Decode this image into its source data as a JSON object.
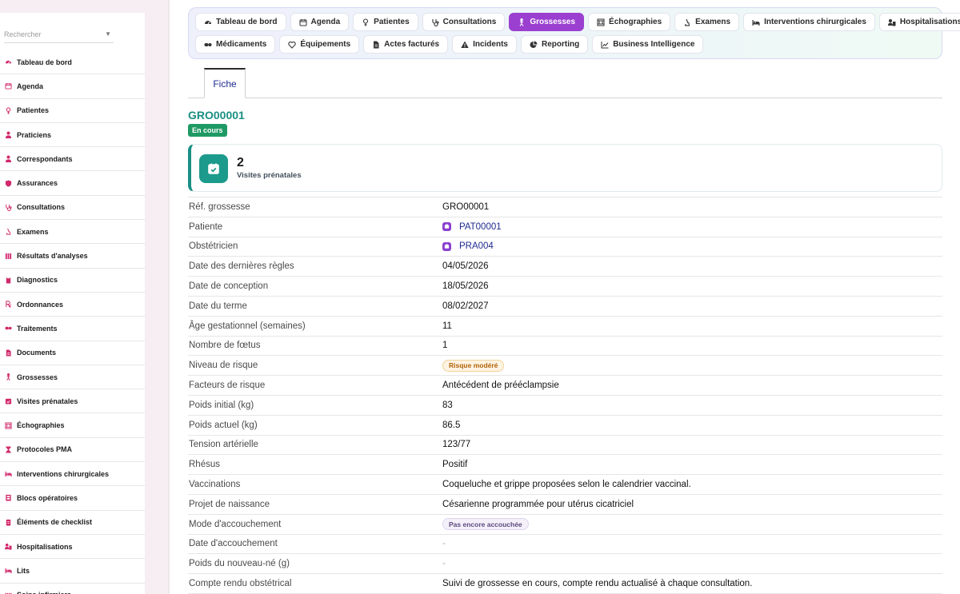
{
  "sidebar": {
    "search_placeholder": "Rechercher",
    "items": [
      {
        "label": "Tableau de bord",
        "icon": "gauge-icon"
      },
      {
        "label": "Agenda",
        "icon": "calendar-icon"
      },
      {
        "label": "Patientes",
        "icon": "female-icon"
      },
      {
        "label": "Praticiens",
        "icon": "doctor-icon"
      },
      {
        "label": "Correspondants",
        "icon": "person-icon"
      },
      {
        "label": "Assurances",
        "icon": "shield-icon"
      },
      {
        "label": "Consultations",
        "icon": "stethoscope-icon"
      },
      {
        "label": "Examens",
        "icon": "microscope-icon"
      },
      {
        "label": "Résultats d'analyses",
        "icon": "lab-icon"
      },
      {
        "label": "Diagnostics",
        "icon": "clipboard-icon"
      },
      {
        "label": "Ordonnances",
        "icon": "prescription-icon"
      },
      {
        "label": "Traitements",
        "icon": "pills-icon"
      },
      {
        "label": "Documents",
        "icon": "document-icon"
      },
      {
        "label": "Grossesses",
        "icon": "pregnancy-icon"
      },
      {
        "label": "Visites prénatales",
        "icon": "calendar-check-icon"
      },
      {
        "label": "Échographies",
        "icon": "ultrasound-icon"
      },
      {
        "label": "Protocoles PMA",
        "icon": "hourglass-icon"
      },
      {
        "label": "Interventions chirurgicales",
        "icon": "bed-icon"
      },
      {
        "label": "Blocs opératoires",
        "icon": "door-icon"
      },
      {
        "label": "Éléments de checklist",
        "icon": "checklist-icon"
      },
      {
        "label": "Hospitalisations",
        "icon": "hospital-icon"
      },
      {
        "label": "Lits",
        "icon": "bed-icon"
      },
      {
        "label": "Soins infirmiers",
        "icon": "nurse-icon"
      }
    ]
  },
  "topnav": {
    "row1": [
      {
        "label": "Tableau de bord",
        "icon": "gauge-icon",
        "active": false
      },
      {
        "label": "Agenda",
        "icon": "calendar-icon",
        "active": false
      },
      {
        "label": "Patientes",
        "icon": "female-icon",
        "active": false
      },
      {
        "label": "Consultations",
        "icon": "stethoscope-icon",
        "active": false
      },
      {
        "label": "Grossesses",
        "icon": "pregnancy-icon",
        "active": true
      },
      {
        "label": "Échographies",
        "icon": "ultrasound-icon",
        "active": false
      },
      {
        "label": "Examens",
        "icon": "microscope-icon",
        "active": false
      },
      {
        "label": "Interventions chirurgicales",
        "icon": "bed-icon",
        "active": false
      },
      {
        "label": "Hospitalisations",
        "icon": "hospital-icon",
        "active": false
      }
    ],
    "row2": [
      {
        "label": "Médicaments",
        "icon": "pills-icon",
        "active": false
      },
      {
        "label": "Équipements",
        "icon": "heart-pulse-icon",
        "active": false
      },
      {
        "label": "Actes facturés",
        "icon": "document-icon",
        "active": false
      },
      {
        "label": "Incidents",
        "icon": "warning-icon",
        "active": false
      },
      {
        "label": "Reporting",
        "icon": "pie-chart-icon",
        "active": false
      },
      {
        "label": "Business Intelligence",
        "icon": "line-chart-icon",
        "active": false
      }
    ]
  },
  "tabs": {
    "fiche": "Fiche"
  },
  "record": {
    "title": "GRO00001",
    "status": "En cours"
  },
  "stat": {
    "value": "2",
    "label": "Visites prénatales",
    "icon": "calendar-check-icon"
  },
  "colors": {
    "accent": "#9b3fd0",
    "teal": "#1a8f83",
    "status_green": "#1f9a64",
    "sidebar_icon": "#d1296b"
  },
  "details": [
    {
      "label": "Réf. grossesse",
      "value": "GRO00001",
      "type": "text"
    },
    {
      "label": "Patiente",
      "value": "PAT00001",
      "type": "link"
    },
    {
      "label": "Obstétricien",
      "value": "PRA004",
      "type": "link"
    },
    {
      "label": "Date des dernières règles",
      "value": "04/05/2026",
      "type": "text"
    },
    {
      "label": "Date de conception",
      "value": "18/05/2026",
      "type": "text"
    },
    {
      "label": "Date du terme",
      "value": "08/02/2027",
      "type": "text"
    },
    {
      "label": "Âge gestationnel (semaines)",
      "value": "11",
      "type": "text"
    },
    {
      "label": "Nombre de fœtus",
      "value": "1",
      "type": "text"
    },
    {
      "label": "Niveau de risque",
      "value": "Risque modéré",
      "type": "pill-warn"
    },
    {
      "label": "Facteurs de risque",
      "value": "Antécédent de prééclampsie",
      "type": "text"
    },
    {
      "label": "Poids initial (kg)",
      "value": "83",
      "type": "text"
    },
    {
      "label": "Poids actuel (kg)",
      "value": "86.5",
      "type": "text"
    },
    {
      "label": "Tension artérielle",
      "value": "123/77",
      "type": "text"
    },
    {
      "label": "Rhésus",
      "value": "Positif",
      "type": "text"
    },
    {
      "label": "Vaccinations",
      "value": "Coqueluche et grippe proposées selon le calendrier vaccinal.",
      "type": "text"
    },
    {
      "label": "Projet de naissance",
      "value": "Césarienne programmée pour utérus cicatriciel",
      "type": "text"
    },
    {
      "label": "Mode d'accouchement",
      "value": "Pas encore accouchée",
      "type": "pill-neutral"
    },
    {
      "label": "Date d'accouchement",
      "value": "-",
      "type": "muted"
    },
    {
      "label": "Poids du nouveau-né (g)",
      "value": "-",
      "type": "muted"
    },
    {
      "label": "Compte rendu obstétrical",
      "value": "Suivi de grossesse en cours, compte rendu actualisé à chaque consultation.",
      "type": "text"
    }
  ]
}
